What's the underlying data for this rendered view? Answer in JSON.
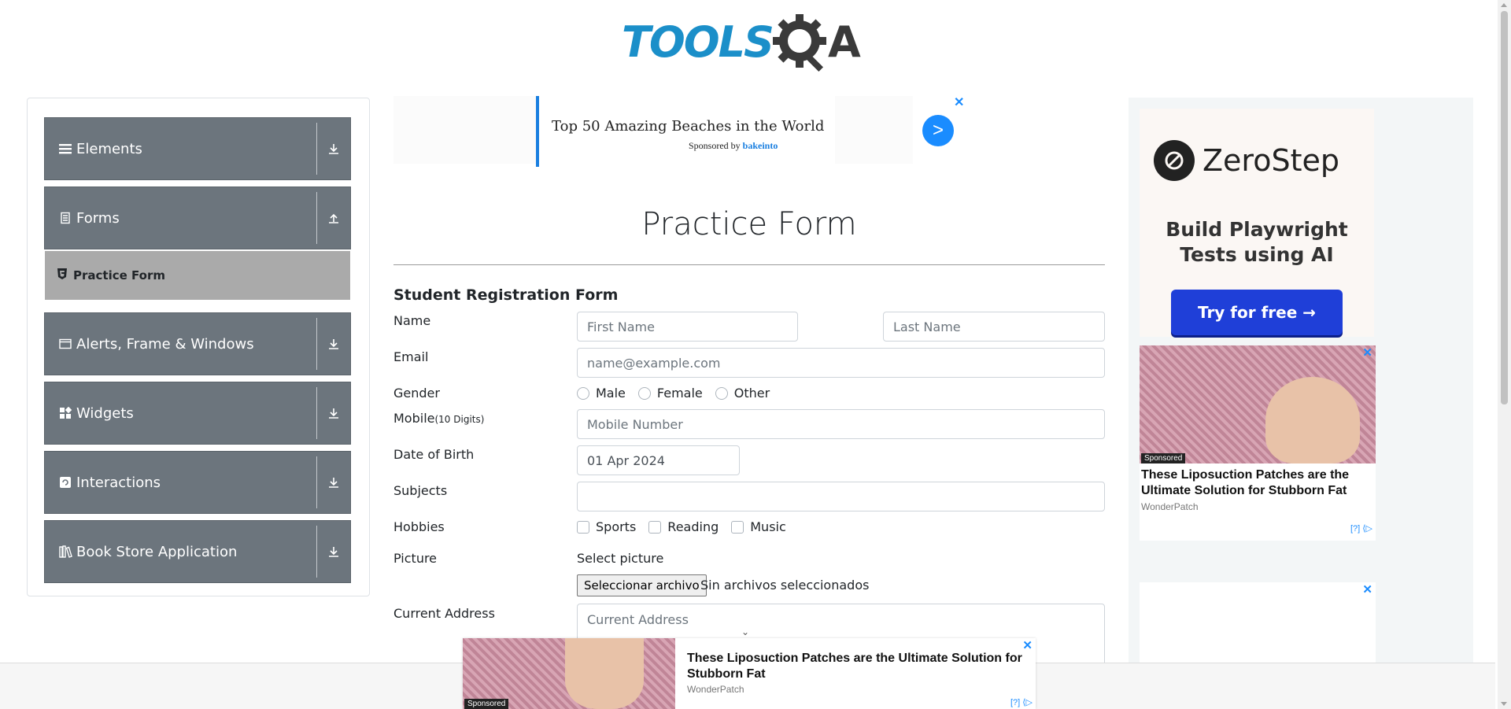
{
  "logo": {
    "text": "TOOLS",
    "suffix": "A"
  },
  "sidebar": {
    "groups": [
      {
        "label": "Elements",
        "icon": "menu-icon",
        "arrow": "download-icon"
      },
      {
        "label": "Forms",
        "icon": "document-icon",
        "arrow": "upload-icon"
      },
      {
        "label": "Alerts, Frame & Windows",
        "icon": "window-icon",
        "arrow": "download-icon"
      },
      {
        "label": "Widgets",
        "icon": "widgets-icon",
        "arrow": "download-icon"
      },
      {
        "label": "Interactions",
        "icon": "interactions-icon",
        "arrow": "download-icon"
      },
      {
        "label": "Book Store Application",
        "icon": "books-icon",
        "arrow": "download-icon"
      }
    ],
    "active_item": {
      "label": "Practice Form",
      "icon": "html5-icon"
    }
  },
  "top_ad": {
    "title": "Top 50 Amazing Beaches in the World",
    "sponsor_prefix": "Sponsored by",
    "sponsor": "bakeinto",
    "go": ">",
    "close": "✕"
  },
  "form": {
    "title": "Practice Form",
    "subtitle": "Student Registration Form",
    "name_label": "Name",
    "first_name_placeholder": "First Name",
    "last_name_placeholder": "Last Name",
    "email_label": "Email",
    "email_placeholder": "name@example.com",
    "gender_label": "Gender",
    "gender_options": [
      "Male",
      "Female",
      "Other"
    ],
    "mobile_label": "Mobile",
    "mobile_hint": "(10 Digits)",
    "mobile_placeholder": "Mobile Number",
    "dob_label": "Date of Birth",
    "dob_value": "01 Apr 2024",
    "subjects_label": "Subjects",
    "hobbies_label": "Hobbies",
    "hobby_options": [
      "Sports",
      "Reading",
      "Music"
    ],
    "picture_label": "Picture",
    "picture_prompt": "Select picture",
    "file_button": "Seleccionar archivo",
    "file_status": "Sin archivos seleccionados",
    "address_label": "Current Address",
    "address_placeholder": "Current Address"
  },
  "right_ads": {
    "zerostep": {
      "brand": "ZeroStep",
      "tagline_1": "Build Playwright",
      "tagline_2": "Tests using AI",
      "button": "Try for free →"
    },
    "lipo": {
      "sponsored": "Sponsored",
      "title": "These Liposuction Patches are the Ultimate Solution for Stubborn Fat",
      "brand": "WonderPatch",
      "info": "[?] ⟨▷"
    },
    "close": "✕"
  },
  "bottom_ad": {
    "sponsored": "Sponsored",
    "title": "These Liposuction Patches are the Ultimate Solution for Stubborn Fat",
    "brand": "WonderPatch",
    "info": "[?] ⟨▷",
    "close": "✕",
    "collapse": "⌄"
  }
}
